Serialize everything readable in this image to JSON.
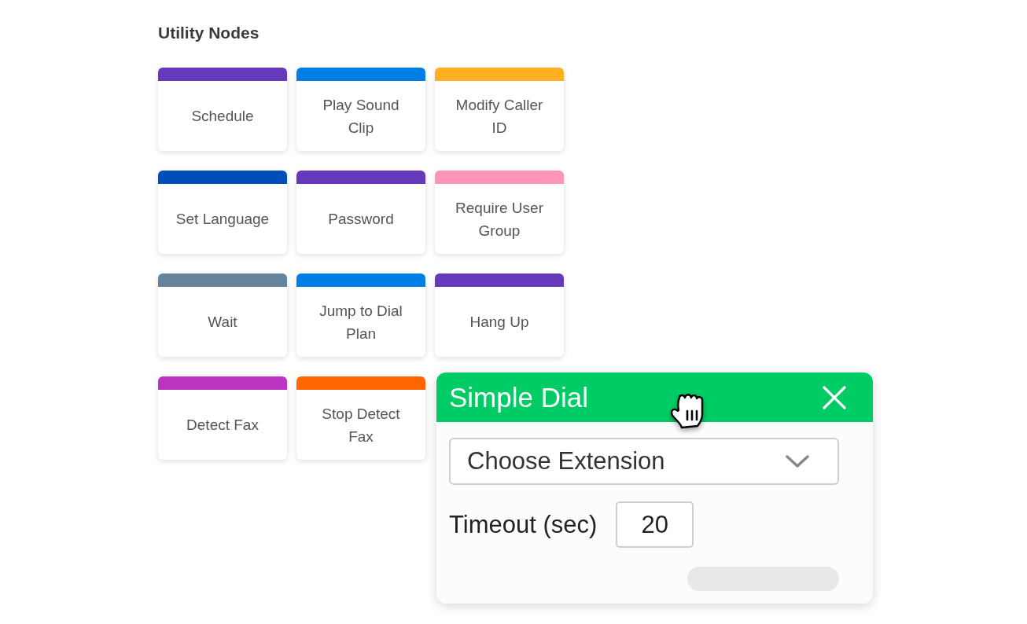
{
  "section": {
    "title": "Utility Nodes",
    "nodes": [
      {
        "label": "Schedule",
        "color": "#6638bb"
      },
      {
        "label": "Play Sound Clip",
        "color": "#007ee6"
      },
      {
        "label": "Modify Caller ID",
        "color": "#ffb020"
      },
      {
        "label": "Set Language",
        "color": "#004fb8"
      },
      {
        "label": "Password",
        "color": "#6638bb"
      },
      {
        "label": "Require User Group",
        "color": "#ff95b8"
      },
      {
        "label": "Wait",
        "color": "#63849c"
      },
      {
        "label": "Jump to Dial Plan",
        "color": "#007ee6"
      },
      {
        "label": "Hang Up",
        "color": "#6638bb"
      },
      {
        "label": "Detect Fax",
        "color": "#bb33c0"
      },
      {
        "label": "Stop Detect Fax",
        "color": "#ff6600"
      }
    ]
  },
  "dialog": {
    "title": "Simple Dial",
    "extension_select": {
      "placeholder": "Choose Extension"
    },
    "timeout": {
      "label": "Timeout (sec)",
      "value": "20"
    }
  }
}
